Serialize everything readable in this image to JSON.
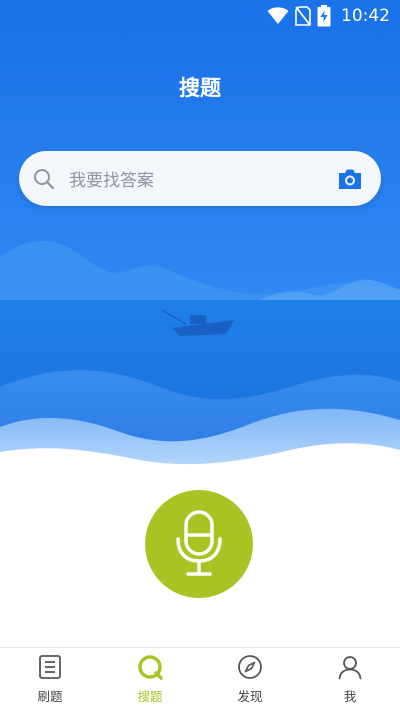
{
  "status_bar": {
    "time": "10:42",
    "icons": [
      "wifi-icon",
      "no-sim-icon",
      "battery-charging-icon"
    ]
  },
  "header": {
    "title": "搜题"
  },
  "search": {
    "placeholder": "我要找答案",
    "left_icon": "search-icon",
    "right_icon": "camera-icon"
  },
  "voice": {
    "icon": "microphone-icon"
  },
  "bottom_nav": {
    "items": [
      {
        "label": "刷题",
        "icon": "list-icon",
        "active": false
      },
      {
        "label": "搜题",
        "icon": "search-circle-icon",
        "active": true
      },
      {
        "label": "发现",
        "icon": "compass-icon",
        "active": false
      },
      {
        "label": "我",
        "icon": "user-icon",
        "active": false
      }
    ]
  },
  "colors": {
    "primary_blue": "#1a73e8",
    "accent_green": "#a8c422",
    "search_bg": "#f3f6fb",
    "nav_text": "#444444"
  }
}
